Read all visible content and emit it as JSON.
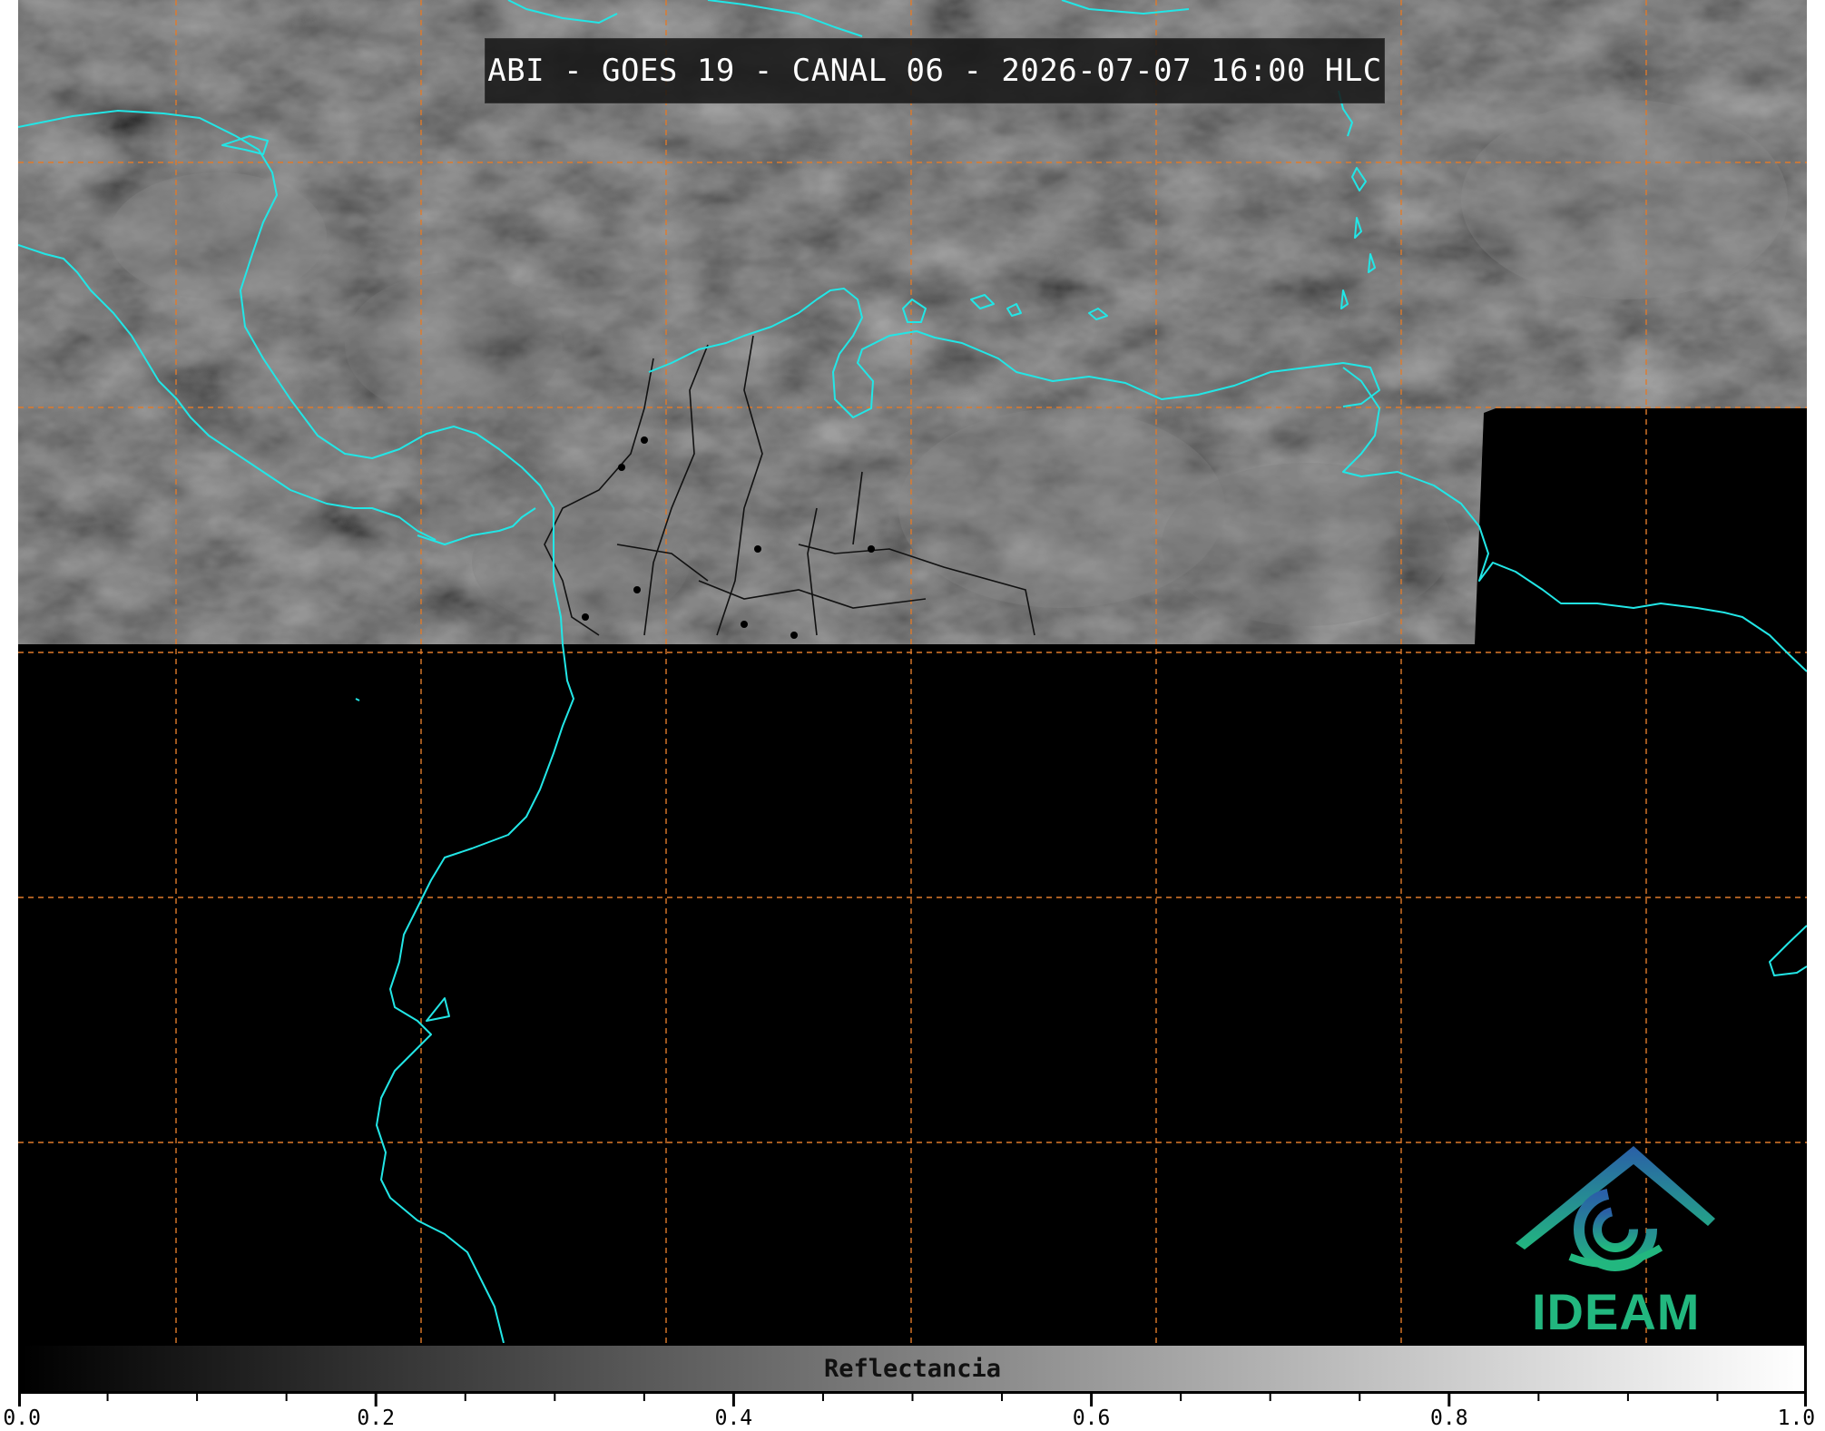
{
  "title": "ABI - GOES 19 - CANAL 06 - 2026-07-07 16:00 HLC",
  "logo": {
    "name": "IDEAM",
    "text": "IDEAM"
  },
  "colorbar": {
    "label": "Reflectancia",
    "min": 0.0,
    "max": 1.0,
    "tick_labels": [
      "0.0",
      "0.2",
      "0.4",
      "0.6",
      "0.8",
      "1.0"
    ],
    "tick_values": [
      0.0,
      0.2,
      0.4,
      0.6,
      0.8,
      1.0
    ],
    "minor_step": 0.05,
    "colormap": "grayscale"
  },
  "map": {
    "grid": true,
    "grid_color": "#e07a2a",
    "coastline_color": "#22e6e6",
    "border_color": "#111111"
  }
}
